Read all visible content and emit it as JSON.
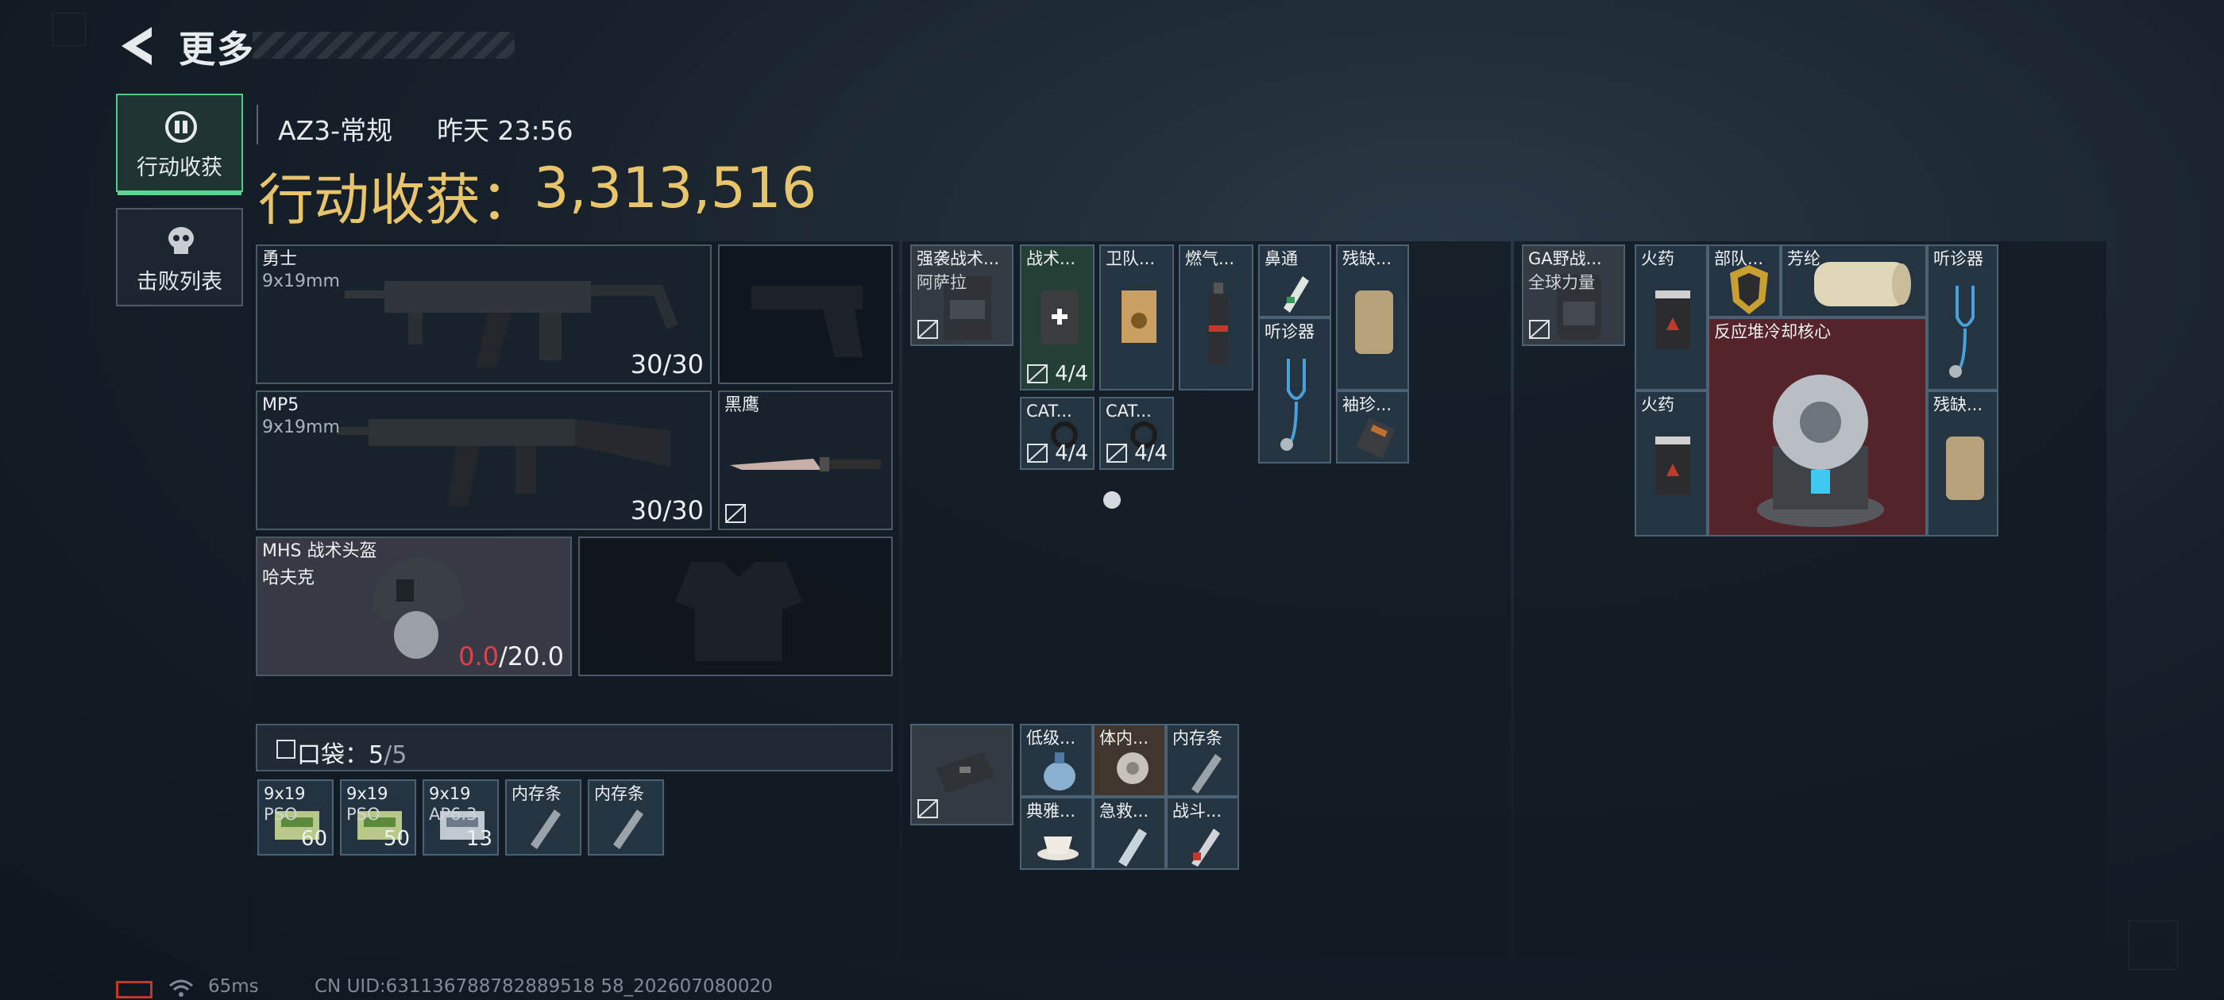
{
  "header": {
    "title": "更多"
  },
  "side_tabs": [
    {
      "label": "行动收获",
      "icon": "loot-icon",
      "active": true
    },
    {
      "label": "击败列表",
      "icon": "skull-icon",
      "active": false
    }
  ],
  "match": {
    "mode": "AZ3-常规",
    "time": "昨天 23:56",
    "earnings_label": "行动收获：",
    "earnings_value": "3,313,516"
  },
  "equipment": {
    "primary": {
      "name": "勇士",
      "caliber": "9x19mm",
      "ammo": "30/30"
    },
    "secondary": {
      "name": "MP5",
      "caliber": "9x19mm",
      "ammo": "30/30"
    },
    "melee": {
      "name": "黑鹰"
    },
    "helmet": {
      "name": "MHS 战术头盔",
      "sub": "哈夫克",
      "durability_current": "0.0",
      "durability_max": "/20.0"
    }
  },
  "pocket": {
    "label": "口袋：",
    "used": "5",
    "capacity": "/5",
    "items": [
      {
        "name": "9x19",
        "sub": "PSO",
        "count": "60"
      },
      {
        "name": "9x19",
        "sub": "PSO",
        "count": "50"
      },
      {
        "name": "9x19",
        "sub": "AP6.3",
        "count": "13"
      },
      {
        "name": "内存条"
      },
      {
        "name": "内存条"
      }
    ]
  },
  "chest_rig": {
    "name": "强袭战术...",
    "sub": "阿萨拉",
    "items": [
      {
        "name": "战术...",
        "count": "4/4"
      },
      {
        "name": "卫队..."
      },
      {
        "name": "燃气..."
      },
      {
        "name": "CAT...",
        "count": "4/4"
      },
      {
        "name": "CAT...",
        "count": "4/4"
      },
      {
        "name": "鼻通"
      },
      {
        "name": "听诊器"
      },
      {
        "name": "残缺..."
      },
      {
        "name": "袖珍..."
      }
    ]
  },
  "safe_box": {
    "items": [
      {
        "name": "低级..."
      },
      {
        "name": "体内..."
      },
      {
        "name": "内存条"
      },
      {
        "name": "典雅..."
      },
      {
        "name": "急救..."
      },
      {
        "name": "战斗..."
      }
    ]
  },
  "backpack": {
    "name": "GA野战...",
    "sub": "全球力量",
    "items": [
      {
        "name": "火药"
      },
      {
        "name": "部队..."
      },
      {
        "name": "芳纶"
      },
      {
        "name": "听诊器"
      },
      {
        "name": "火药"
      },
      {
        "name": "反应堆冷却核心"
      },
      {
        "name": "残缺..."
      }
    ]
  },
  "status": {
    "ping": "65ms",
    "uid": "CN UID:631136788782889518 58_202607080020"
  },
  "colors": {
    "earnings": "#e8c46a",
    "active_tab": "#5fd490",
    "durability_zero": "#e0404a",
    "legendary": "#8a2e3a"
  }
}
